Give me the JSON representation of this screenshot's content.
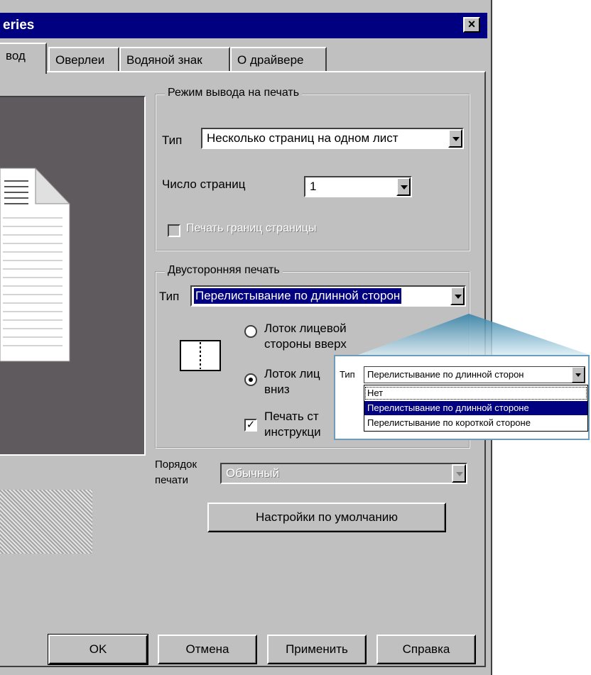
{
  "window": {
    "title": "eries",
    "close_glyph": "×"
  },
  "tabs": [
    {
      "label": "вод"
    },
    {
      "label": "Оверлеи"
    },
    {
      "label": "Водяной знак"
    },
    {
      "label": "О драйвере"
    }
  ],
  "output_mode": {
    "group_title": "Режим вывода на печать",
    "type_label": "Тип",
    "type_value": "Несколько страниц на одном лист",
    "pages_label": "Число страниц",
    "pages_value": "1",
    "border_label": "Печать границ страницы"
  },
  "duplex": {
    "group_title": "Двусторонняя печать",
    "type_label": "Тип",
    "type_value": "Перелистывание по длинной сторон",
    "tray_face_up": "Лоток лицевой стороны вверх",
    "tray_face_down": "Лоток лиц вниз",
    "print_instructions": "Печать ст инструкци",
    "face_down_selected": true,
    "print_instructions_checked": true
  },
  "order": {
    "label_line1": "Порядок",
    "label_line2": "печати",
    "value": "Обычный"
  },
  "defaults_button": "Настройки по умолчанию",
  "buttons": {
    "ok": "OK",
    "cancel": "Отмена",
    "apply": "Применить",
    "help": "Справка"
  },
  "callout": {
    "type_label": "Тип",
    "combo_value": "Перелистывание по длинной сторон",
    "options": [
      "Нет",
      "Перелистывание по длинной стороне",
      "Перелистывание по короткой стороне"
    ],
    "selected_index": 1
  }
}
